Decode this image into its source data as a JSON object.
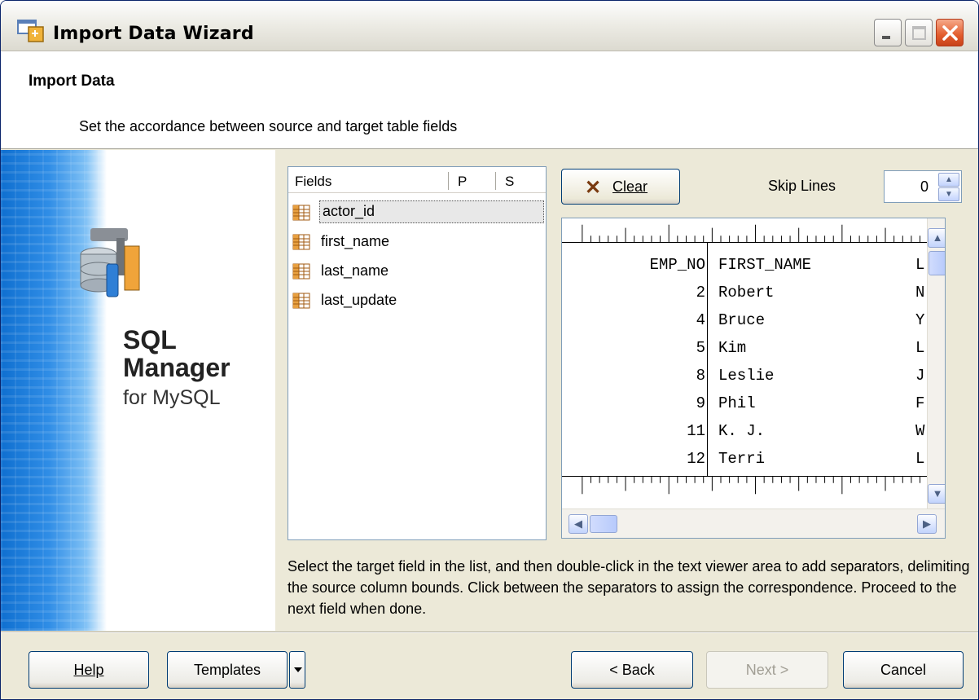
{
  "window": {
    "title": "Import Data Wizard",
    "controls": [
      "minimize-icon",
      "maximize-icon",
      "close-icon"
    ]
  },
  "header": {
    "title": "Import Data",
    "subtitle": "Set the accordance between source and target table fields"
  },
  "banner": {
    "line1": "SQL",
    "line2": "Manager",
    "line3": "for MySQL"
  },
  "fields_list": {
    "columns": [
      "Fields",
      "P",
      "S"
    ],
    "items": [
      {
        "name": "actor_id",
        "selected": true
      },
      {
        "name": "first_name",
        "selected": false
      },
      {
        "name": "last_name",
        "selected": false
      },
      {
        "name": "last_update",
        "selected": false
      }
    ]
  },
  "toolbar": {
    "clear_label": "Clear",
    "skip_lines_label": "Skip Lines",
    "skip_lines_value": "0"
  },
  "viewer": {
    "rows": [
      {
        "c1": "EMP_NO",
        "c2": "FIRST_NAME",
        "c3": "L"
      },
      {
        "c1": "2",
        "c2": "Robert",
        "c3": "N"
      },
      {
        "c1": "4",
        "c2": "Bruce",
        "c3": "Y"
      },
      {
        "c1": "5",
        "c2": "Kim",
        "c3": "L"
      },
      {
        "c1": "8",
        "c2": "Leslie",
        "c3": "J"
      },
      {
        "c1": "9",
        "c2": "Phil",
        "c3": "F"
      },
      {
        "c1": "11",
        "c2": "K. J.",
        "c3": "W"
      },
      {
        "c1": "12",
        "c2": "Terri",
        "c3": "L"
      }
    ]
  },
  "info_text": "Select the target field in the list, and then double-click in the text viewer area to add separators, delimiting the source column bounds. Click between the separators to assign the correspondence. Proceed to the next field when done.",
  "buttons": {
    "help": "Help",
    "templates": "Templates",
    "back": "< Back",
    "next": "Next >",
    "cancel": "Cancel"
  },
  "colors": {
    "window_bg": "#ece9d8",
    "border_blue": "#003c74",
    "banner_blue": "#2f8de6"
  }
}
